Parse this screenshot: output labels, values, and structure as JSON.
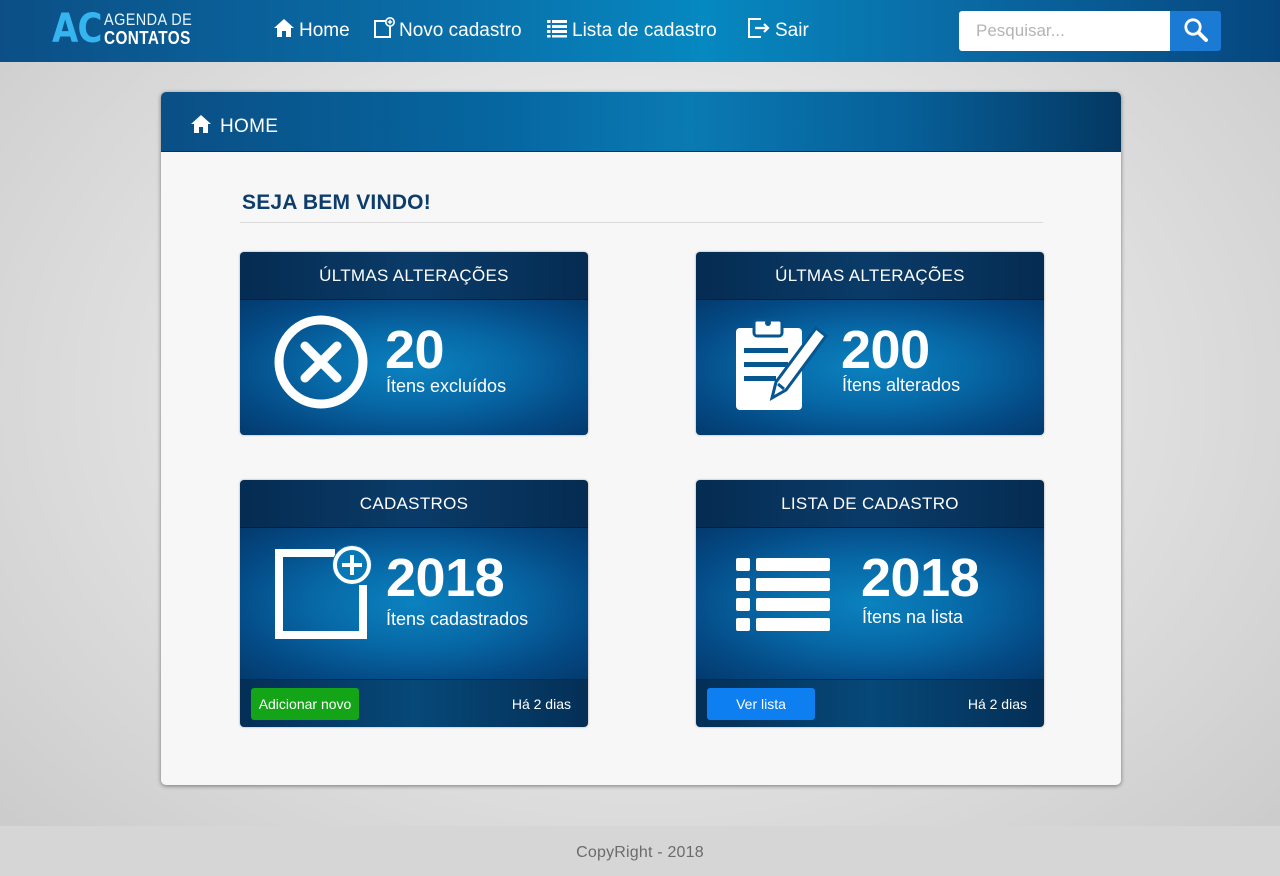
{
  "brand": {
    "logo_initials": "AC",
    "logo_line1": "AGENDA DE",
    "logo_line2": "CONTATOS"
  },
  "nav": {
    "items": [
      {
        "label": "Home",
        "icon": "home-icon"
      },
      {
        "label": "Novo cadastro",
        "icon": "new-record-icon"
      },
      {
        "label": "Lista de cadastro",
        "icon": "list-icon"
      },
      {
        "label": "Sair",
        "icon": "logout-icon"
      }
    ]
  },
  "search": {
    "placeholder": "Pesquisar...",
    "value": "",
    "button_icon": "search-icon"
  },
  "panel": {
    "title": "HOME",
    "title_icon": "home-icon",
    "welcome": "SEJA BEM VINDO!"
  },
  "cards": [
    {
      "header": "ÚLTMAS ALTERAÇÕES",
      "number": "20",
      "label": "Ítens excluídos",
      "icon": "delete-circle-icon"
    },
    {
      "header": "ÚLTMAS ALTERAÇÕES",
      "number": "200",
      "label": "Ítens alterados",
      "icon": "clipboard-edit-icon"
    },
    {
      "header": "CADASTROS",
      "number": "2018",
      "label": "Ítens cadastrados",
      "icon": "add-square-icon",
      "button": "Adicionar novo",
      "time": "Há 2 dias"
    },
    {
      "header": "LISTA DE CADASTRO",
      "number": "2018",
      "label": "Ítens na lista",
      "icon": "list-icon",
      "button": "Ver lista",
      "time": "Há 2 dias"
    }
  ],
  "colors": {
    "accent": "#1b7ad4",
    "add_button": "#13a418",
    "list_button": "#0d7ff0",
    "welcome_text": "#0d3d6c"
  },
  "footer": {
    "copyright": "CopyRight - 2018"
  }
}
